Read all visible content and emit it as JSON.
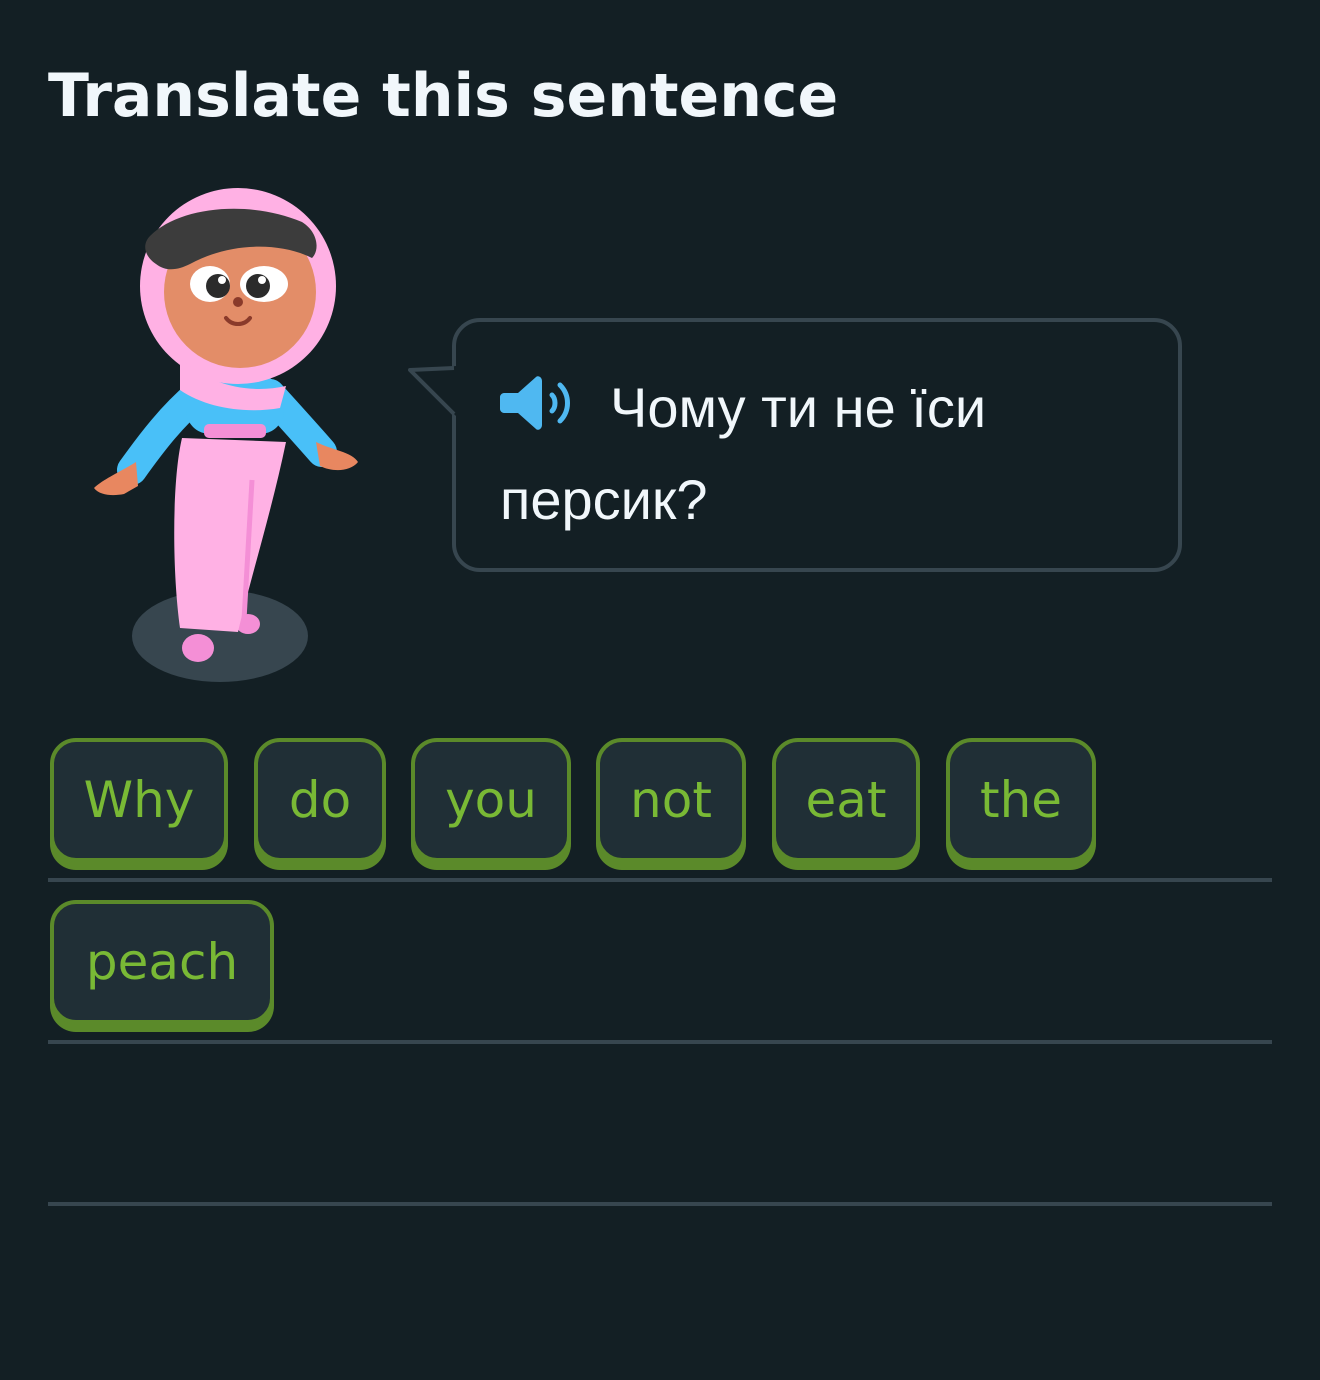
{
  "header": {
    "title": "Translate this sentence"
  },
  "character": {
    "icon": "character-illustration"
  },
  "prompt": {
    "speaker_icon": "speaker-icon",
    "text": "Чому ти не їси персик?"
  },
  "answer_words": [
    {
      "label": "Why"
    },
    {
      "label": "do"
    },
    {
      "label": "you"
    },
    {
      "label": "not"
    },
    {
      "label": "eat"
    },
    {
      "label": "the"
    },
    {
      "label": "peach"
    }
  ],
  "colors": {
    "background": "#131f24",
    "chip_border": "#5b8a2a",
    "chip_text": "#79b935",
    "speaker": "#4fb8f1",
    "divider": "#37464f"
  }
}
